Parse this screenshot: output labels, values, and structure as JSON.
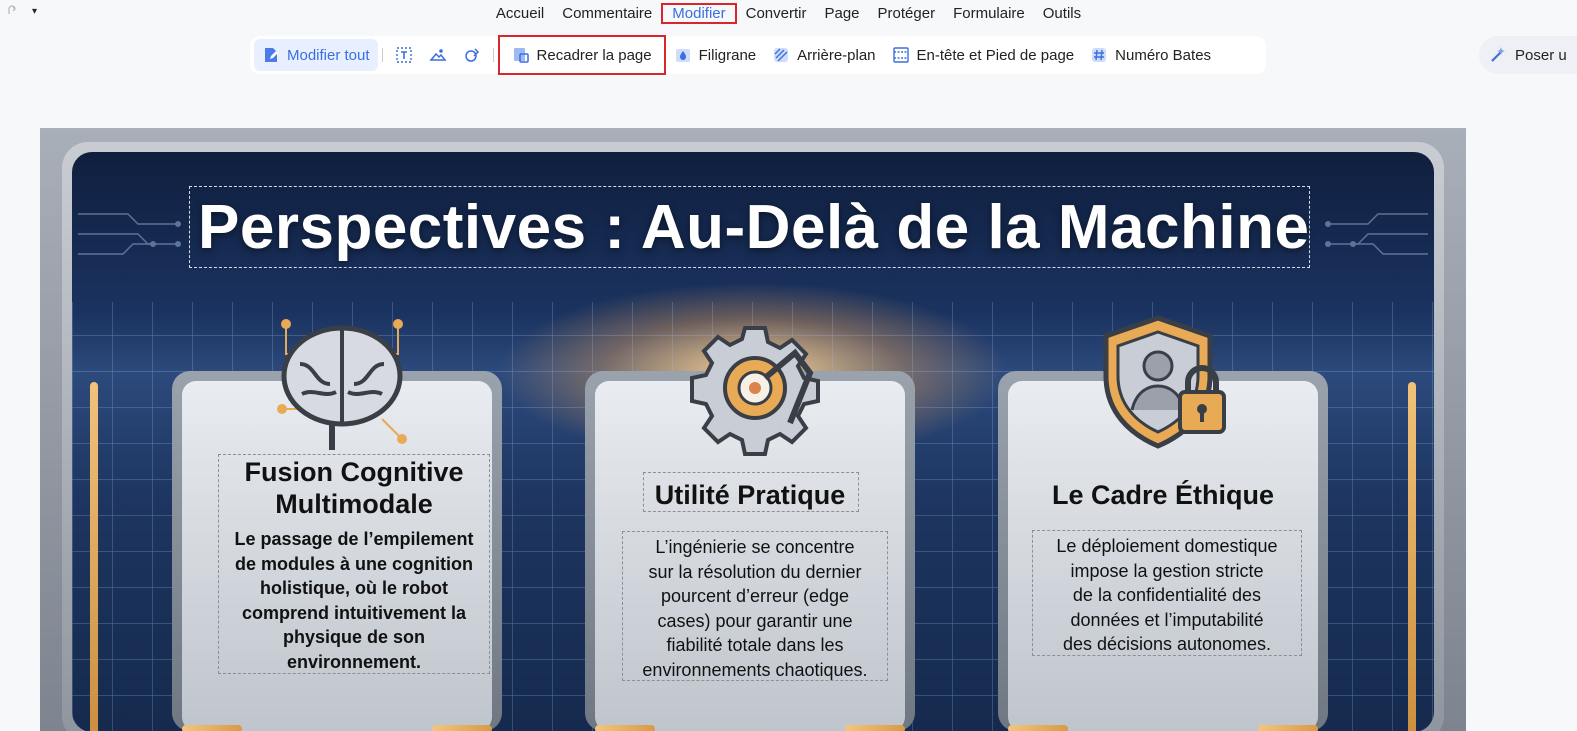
{
  "quick": {
    "redo_icon": "redo-icon",
    "dropdown_icon": "chevron-down-icon",
    "dropdown_glyph": "▾"
  },
  "menu": {
    "items": [
      "Accueil",
      "Commentaire",
      "Modifier",
      "Convertir",
      "Page",
      "Protéger",
      "Formulaire",
      "Outils"
    ],
    "active": "Modifier"
  },
  "toolbar": {
    "edit_all": "Modifier tout",
    "crop_page": "Recadrer la page",
    "watermark": "Filigrane",
    "background": "Arrière-plan",
    "header_footer": "En-tête et Pied de page",
    "bates": "Numéro Bates",
    "icons": [
      "edit-text-icon",
      "edit-image-icon",
      "edit-link-icon"
    ]
  },
  "assistant": {
    "label": "Poser u"
  },
  "document": {
    "title": "Perspectives : Au-Delà de la Machine",
    "cards": [
      {
        "icon": "brain-circuit-icon",
        "title_lines": [
          "Fusion Cognitive",
          "Multimodale"
        ],
        "body_lines": [
          "Le passage de l’empilement",
          "de modules à une cognition",
          "holistique, où le robot",
          "comprend intuitivement la",
          "physique de son",
          "environnement."
        ]
      },
      {
        "icon": "gear-robot-arm-icon",
        "title_lines": [
          "Utilité Pratique"
        ],
        "body_lines": [
          "L’ingénierie se concentre",
          "sur la résolution du dernier",
          "pourcent d’erreur (edge",
          "cases) pour garantir une",
          "fiabilité totale dans les",
          "environnements chaotiques."
        ]
      },
      {
        "icon": "shield-lock-icon",
        "title_lines": [
          "Le Cadre Éthique"
        ],
        "body_lines": [
          "Le déploiement domestique",
          "impose la gestion stricte",
          "de la confidentialité des",
          "données et l’imputabilité",
          "des décisions autonomes."
        ]
      }
    ]
  },
  "colors": {
    "accent": "#3b6fe0",
    "highlight_box": "#d9262c",
    "gold": "#e8aa55"
  }
}
